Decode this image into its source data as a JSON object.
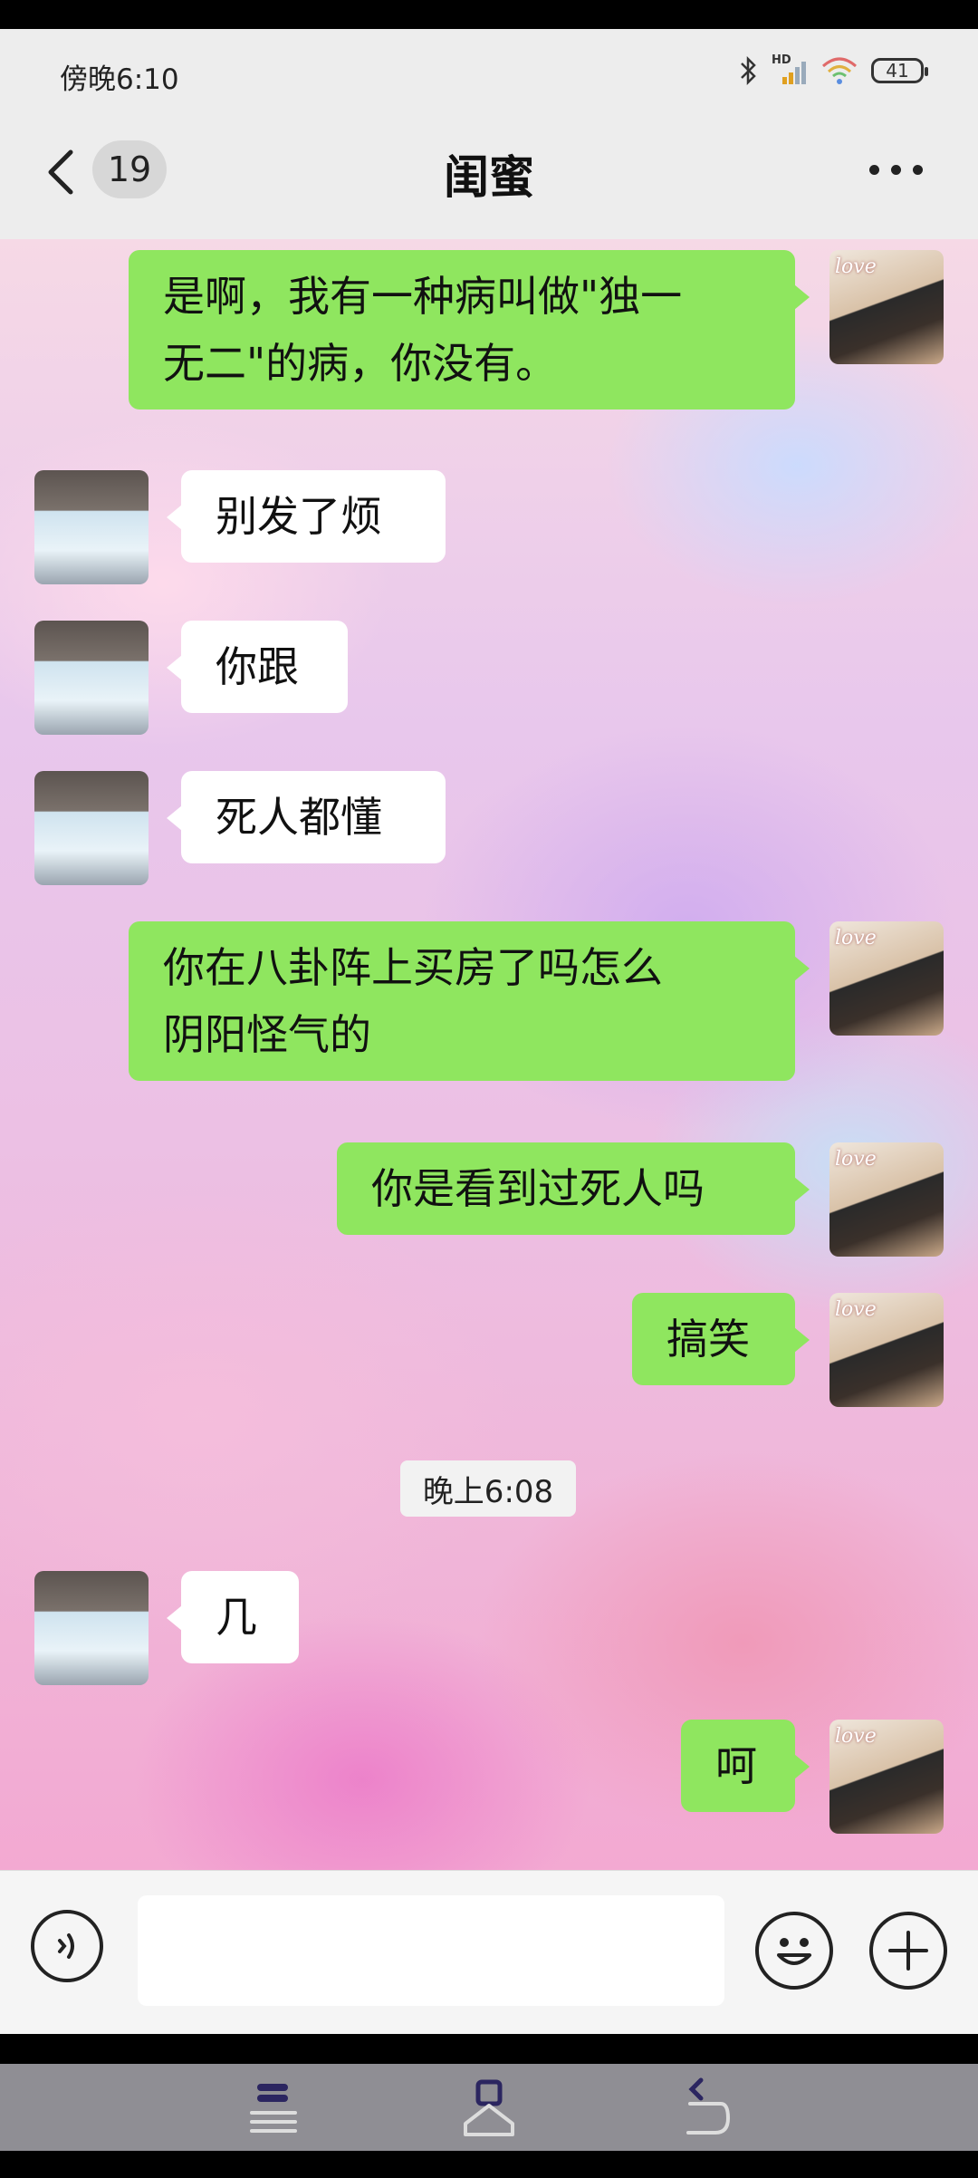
{
  "status_bar": {
    "time": "傍晚6:10",
    "battery": "41",
    "network_label": "HD"
  },
  "header": {
    "unread_count": "19",
    "title": "闺蜜"
  },
  "messages": [
    {
      "sender": "me",
      "text_lines": [
        "是啊，我有一种病叫做\"独一",
        "无二\"的病，你没有。"
      ]
    },
    {
      "sender": "friend",
      "text_lines": [
        "别发了烦"
      ]
    },
    {
      "sender": "friend",
      "text_lines": [
        "你跟"
      ]
    },
    {
      "sender": "friend",
      "text_lines": [
        "死人都懂"
      ]
    },
    {
      "sender": "me",
      "text_lines": [
        "你在八卦阵上买房了吗怎么",
        "阴阳怪气的"
      ]
    },
    {
      "sender": "me",
      "text_lines": [
        "你是看到过死人吗"
      ]
    },
    {
      "sender": "me",
      "text_lines": [
        "搞笑"
      ]
    },
    {
      "sender": "friend",
      "text_lines": [
        "几"
      ]
    },
    {
      "sender": "me",
      "text_lines": [
        "呵"
      ]
    }
  ],
  "timestamp": "晚上6:08",
  "avatar_me_text": "love",
  "input": {
    "value": "",
    "placeholder": ""
  },
  "icons": {
    "back": "chevron-left-icon",
    "more": "more-horizontal-icon",
    "voice": "voice-icon",
    "emoji": "emoji-icon",
    "plus": "plus-icon",
    "nav_menu": "menu-icon",
    "nav_home": "home-icon",
    "nav_back": "back-icon"
  },
  "colors": {
    "my_bubble": "#8fe65f",
    "friend_bubble": "#ffffff",
    "header_bg": "#ededed",
    "navbar_bg": "#8f8e94"
  }
}
